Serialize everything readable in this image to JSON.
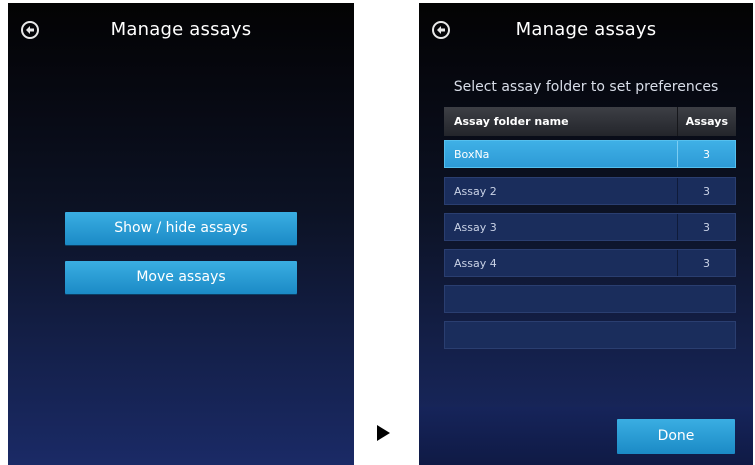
{
  "left_screen": {
    "title": "Manage assays",
    "buttons": [
      {
        "label": "Show / hide assays"
      },
      {
        "label": "Move assays"
      }
    ]
  },
  "right_screen": {
    "title": "Manage assays",
    "subtitle": "Select assay folder to set preferences",
    "table": {
      "columns": [
        "Assay folder name",
        "Assays"
      ],
      "rows": [
        {
          "name": "BoxNa",
          "count": "3",
          "selected": true
        },
        {
          "name": "Assay 2",
          "count": "3",
          "selected": false
        },
        {
          "name": "Assay 3",
          "count": "3",
          "selected": false
        },
        {
          "name": "Assay 4",
          "count": "3",
          "selected": false
        },
        {
          "name": "",
          "count": "",
          "selected": false
        },
        {
          "name": "",
          "count": "",
          "selected": false
        }
      ]
    },
    "done_label": "Done"
  },
  "icons": {
    "back": "back-arrow-icon",
    "transition": "play-arrow-icon"
  },
  "colors": {
    "button_blue": "#2a9dd6",
    "selected_row": "#3fb0e6",
    "background_navy": "#1a2a66"
  }
}
